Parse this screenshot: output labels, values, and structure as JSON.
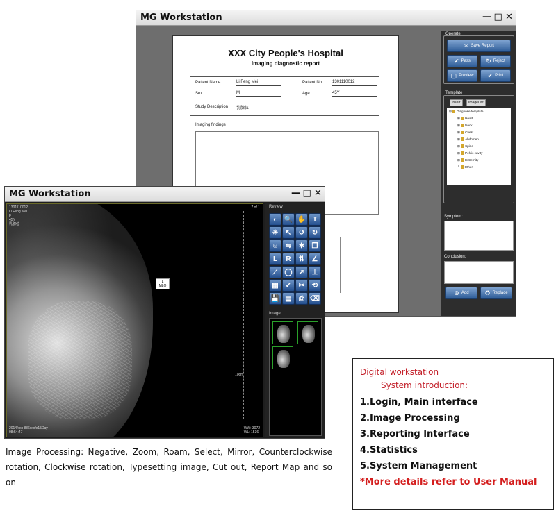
{
  "back_window": {
    "title": "MG Workstation",
    "controls": [
      "—",
      "□",
      "✕"
    ],
    "report": {
      "hospital": "XXX City People's Hospital",
      "subtitle": "Imaging diagnostic report",
      "fields": {
        "patient_name_label": "Patient Name",
        "patient_name_value": "Li Feng Mei",
        "patient_no_label": "Patient No",
        "patient_no_value": "1301110012",
        "sex_label": "Sex",
        "sex_value": "M",
        "age_label": "Age",
        "age_value": "45Y",
        "study_desc_label": "Study Description",
        "study_desc_value": "乳腺位"
      },
      "imaging_findings_label": "Imaging findings"
    },
    "operate": {
      "label": "Operate",
      "save_report": "Save Report",
      "pass": "Pass",
      "reject": "Reject",
      "preview": "Preview",
      "print": "Print"
    },
    "template": {
      "label": "Template",
      "tabs": [
        "Insert",
        "ImageList"
      ],
      "root": "Diagnose template",
      "items": [
        "Head",
        "Neck",
        "Chest",
        "Abdomen",
        "Spine",
        "Pelvic cavity",
        "Extremity",
        "Other"
      ]
    },
    "symptom_label": "Symptom:",
    "conclusion_label": "Conclusion:",
    "add": "Add",
    "replace": "Replace"
  },
  "front_window": {
    "title": "MG Workstation",
    "controls": [
      "—",
      "□",
      "✕"
    ],
    "viewport": {
      "top_left": "1301110012\nLi Feng Mei\nF\n45Y\n乳腺位",
      "top_right": "7 of 1",
      "view_marker": "L\nMLO",
      "bottom_left": "2014/xxx 886xxxfe15Day\n08:54:47",
      "bottom_right": "WW: 3072\nWL: 1536",
      "ruler_label": "10cm"
    },
    "review_label": "Review",
    "image_label": "Image",
    "tools": [
      {
        "name": "negative-icon",
        "glyph": "◐"
      },
      {
        "name": "zoom-icon",
        "glyph": "🔍"
      },
      {
        "name": "roam-icon",
        "glyph": "✋"
      },
      {
        "name": "text-icon",
        "glyph": "T"
      },
      {
        "name": "window-level-icon",
        "glyph": "☀"
      },
      {
        "name": "select-icon",
        "glyph": "↖"
      },
      {
        "name": "ccw-rotate-icon",
        "glyph": "↺"
      },
      {
        "name": "cw-rotate-icon",
        "glyph": "↻"
      },
      {
        "name": "face-icon",
        "glyph": "☺"
      },
      {
        "name": "mirror-icon",
        "glyph": "⇋"
      },
      {
        "name": "person-icon",
        "glyph": "✱"
      },
      {
        "name": "copy-icon",
        "glyph": "❐"
      },
      {
        "name": "left-marker-icon",
        "glyph": "L"
      },
      {
        "name": "right-marker-icon",
        "glyph": "R"
      },
      {
        "name": "flip-icon",
        "glyph": "⇅"
      },
      {
        "name": "angle-icon",
        "glyph": "∠"
      },
      {
        "name": "ruler-icon",
        "glyph": "⟋"
      },
      {
        "name": "ellipse-icon",
        "glyph": "◯"
      },
      {
        "name": "arrow-icon",
        "glyph": "➚"
      },
      {
        "name": "cobb-icon",
        "glyph": "⊥"
      },
      {
        "name": "layout-icon",
        "glyph": "▦"
      },
      {
        "name": "check-icon",
        "glyph": "✓"
      },
      {
        "name": "cut-icon",
        "glyph": "✂"
      },
      {
        "name": "reset-icon",
        "glyph": "⟲"
      },
      {
        "name": "save-icon",
        "glyph": "💾"
      },
      {
        "name": "report-map-icon",
        "glyph": "▤"
      },
      {
        "name": "print-icon",
        "glyph": "⎙"
      },
      {
        "name": "eraser-icon",
        "glyph": "⌫"
      }
    ]
  },
  "caption": "Image Processing: Negative, Zoom, Roam, Select, Mirror, Counterclockwise rotation, Clockwise rotation, Typesetting image, Cut out, Report Map and so on",
  "intro": {
    "title": "Digital workstation",
    "subtitle": "System introduction:",
    "items": [
      "1.Login, Main interface",
      "2.Image Processing",
      "3.Reporting Interface",
      "4.Statistics",
      "5.System Management"
    ],
    "note": "*More details refer to User Manual"
  },
  "colors": {
    "button_blue": "#2f5d98",
    "accent_red": "#c3202a",
    "thumb_green": "#2aa02a"
  }
}
